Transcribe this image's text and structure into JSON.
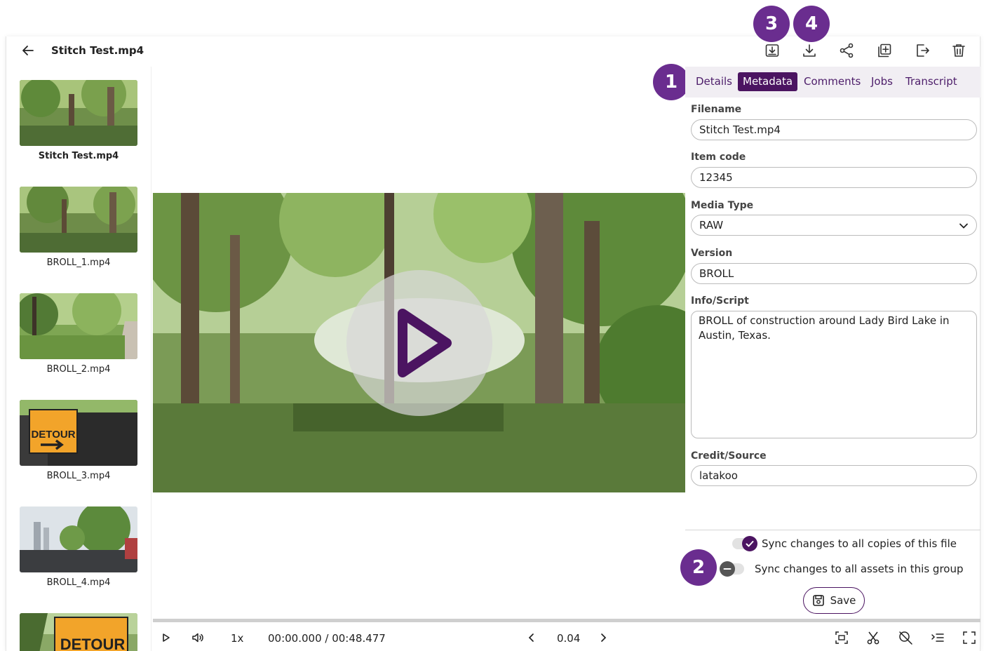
{
  "header": {
    "title": "Stitch Test.mp4"
  },
  "badges": [
    "1",
    "2",
    "3",
    "4"
  ],
  "sidebar": {
    "items": [
      {
        "label": "Stitch Test.mp4"
      },
      {
        "label": "BROLL_1.mp4"
      },
      {
        "label": "BROLL_2.mp4"
      },
      {
        "label": "BROLL_3.mp4"
      },
      {
        "label": "BROLL_4.mp4"
      }
    ],
    "detour_sign": "DETOUR",
    "detour_sign_small": "DETOUR"
  },
  "tabs": [
    {
      "label": "Details"
    },
    {
      "label": "Metadata"
    },
    {
      "label": "Comments"
    },
    {
      "label": "Jobs"
    },
    {
      "label": "Transcript"
    }
  ],
  "form": {
    "filename_label": "Filename",
    "filename_value": "Stitch Test.mp4",
    "item_code_label": "Item code",
    "item_code_value": "12345",
    "media_type_label": "Media Type",
    "media_type_value": "RAW",
    "version_label": "Version",
    "version_value": "BROLL",
    "info_label": "Info/Script",
    "info_value": "BROLL of construction around Lady Bird Lake in Austin, Texas.",
    "credit_label": "Credit/Source",
    "credit_value": "latakoo"
  },
  "sync": {
    "copies_label": "Sync changes to all copies of this file",
    "group_label": "Sync changes to all assets in this group"
  },
  "save_label": "Save",
  "player": {
    "speed": "1x",
    "time": "00:00.000 / 00:48.477",
    "frame_step": "0.04"
  },
  "colors": {
    "accent": "#4b1461",
    "badge": "#6a2d8f",
    "tab_bar_bg": "#f1eef3"
  }
}
